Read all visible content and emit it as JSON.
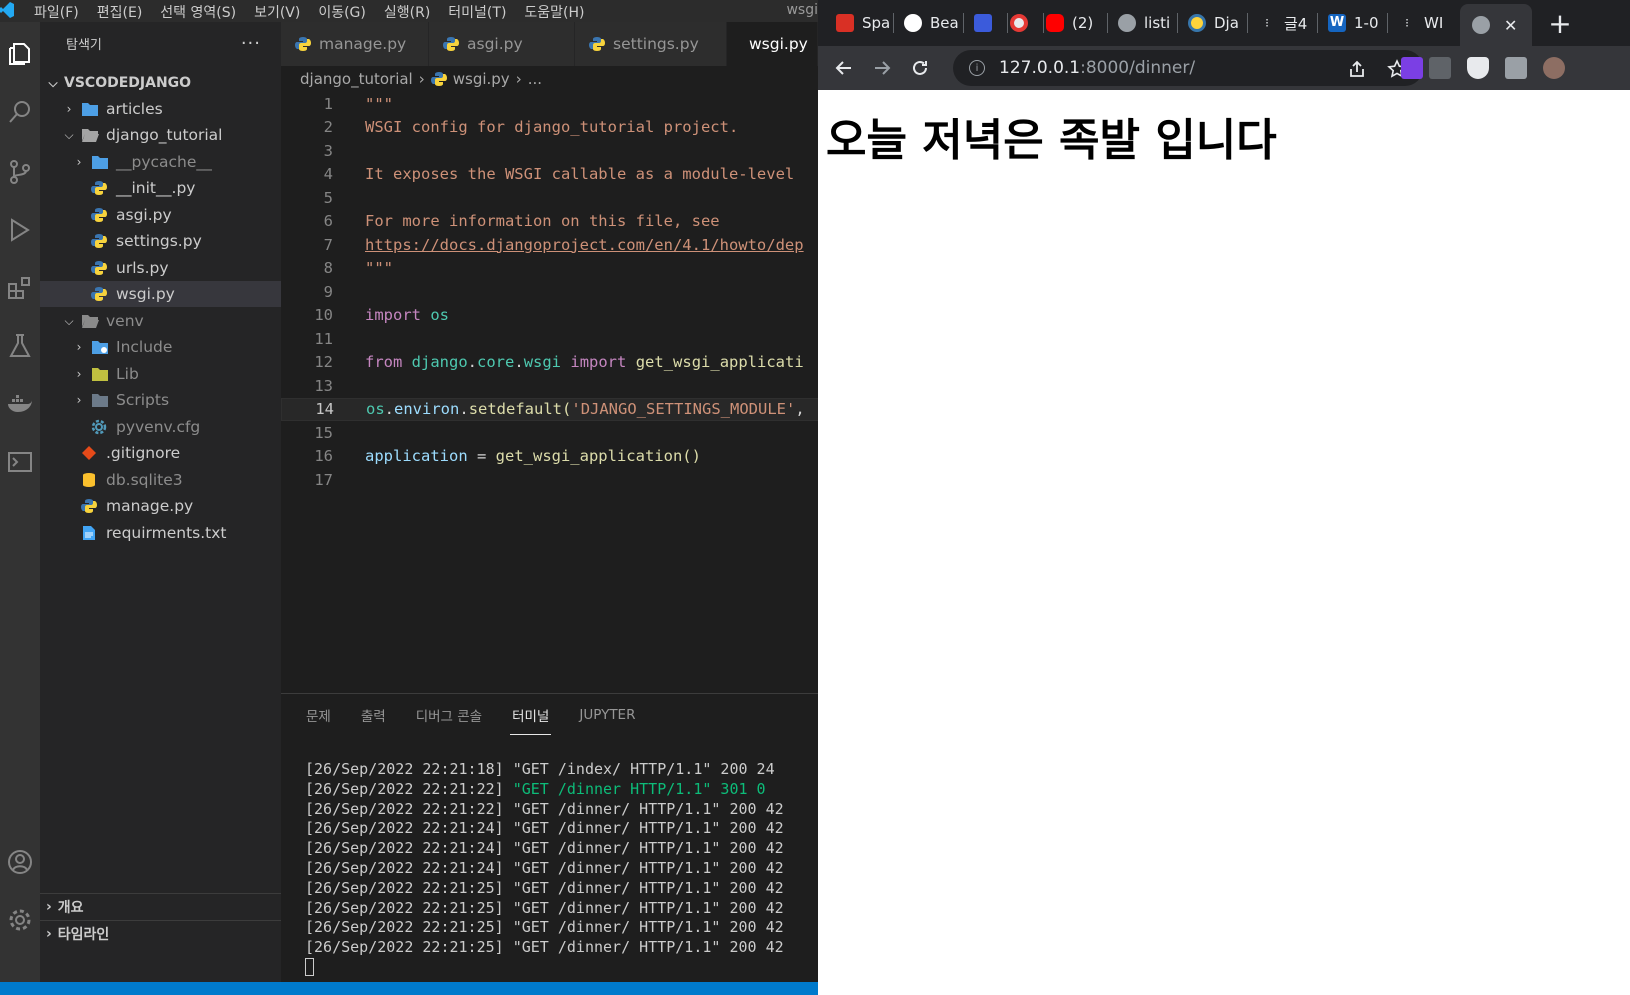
{
  "vscode": {
    "menu": [
      "파일(F)",
      "편집(E)",
      "선택 영역(S)",
      "보기(V)",
      "이동(G)",
      "실행(R)",
      "터미널(T)",
      "도움말(H)"
    ],
    "title_right": "wsgi",
    "explorer_title": "탐색기",
    "explorer_more": "···",
    "tree": {
      "root": "VSCODEDJANGO",
      "articles": "articles",
      "django_tutorial": "django_tutorial",
      "pycache": "__pycache__",
      "init": "__init__.py",
      "asgi": "asgi.py",
      "settings": "settings.py",
      "urls": "urls.py",
      "wsgi": "wsgi.py",
      "venv": "venv",
      "include": "Include",
      "lib": "Lib",
      "scripts": "Scripts",
      "pyvenv": "pyvenv.cfg",
      "gitignore": ".gitignore",
      "db": "db.sqlite3",
      "manage": "manage.py",
      "requirements": "requirments.txt"
    },
    "outline_label": "개요",
    "timeline_label": "타임라인",
    "tabs": [
      "manage.py",
      "asgi.py",
      "settings.py",
      "wsgi.py"
    ],
    "breadcrumb": {
      "folder": "django_tutorial",
      "file": "wsgi.py",
      "more": "..."
    },
    "code": {
      "l1": "\"\"\"",
      "l2": "WSGI config for django_tutorial project.",
      "l4": "It exposes the WSGI callable as a module-level",
      "l6": "For more information on this file, see",
      "l7": "https://docs.djangoproject.com/en/4.1/howto/dep",
      "l8": "\"\"\"",
      "l10_kw": "import",
      "l10_mod": "os",
      "l12_from": "from",
      "l12_mod1": "django",
      "l12_mod2": "core",
      "l12_mod3": "wsgi",
      "l12_import": "import",
      "l12_fn": "get_wsgi_applicati",
      "l14_os": "os",
      "l14_environ": "environ",
      "l14_fn": "setdefault",
      "l14_str": "'DJANGO_SETTINGS_MODULE'",
      "l16_var": "application",
      "l16_eq": " = ",
      "l16_fn": "get_wsgi_application",
      "l16_paren": "()"
    },
    "line_numbers": [
      "1",
      "2",
      "3",
      "4",
      "5",
      "6",
      "7",
      "8",
      "9",
      "10",
      "11",
      "12",
      "13",
      "14",
      "15",
      "16",
      "17"
    ],
    "panel_tabs": [
      "문제",
      "출력",
      "디버그 콘솔",
      "터미널",
      "JUPYTER"
    ],
    "terminal_lines": [
      "[26/Sep/2022 22:21:18] \"GET /index/ HTTP/1.1\" 200 24",
      "[26/Sep/2022 22:21:22] ",
      "[26/Sep/2022 22:21:22] \"GET /dinner/ HTTP/1.1\" 200 42",
      "[26/Sep/2022 22:21:24] \"GET /dinner/ HTTP/1.1\" 200 42",
      "[26/Sep/2022 22:21:24] \"GET /dinner/ HTTP/1.1\" 200 42",
      "[26/Sep/2022 22:21:24] \"GET /dinner/ HTTP/1.1\" 200 42",
      "[26/Sep/2022 22:21:25] \"GET /dinner/ HTTP/1.1\" 200 42",
      "[26/Sep/2022 22:21:25] \"GET /dinner/ HTTP/1.1\" 200 42",
      "[26/Sep/2022 22:21:25] \"GET /dinner/ HTTP/1.1\" 200 42",
      "[26/Sep/2022 22:21:25] \"GET /dinner/ HTTP/1.1\" 200 42"
    ],
    "terminal_redirect": "\"GET /dinner HTTP/1.1\" 301 0",
    "colors": {
      "accent": "#007acc",
      "redirect_green": "#0dbc79"
    }
  },
  "chrome": {
    "tabs": [
      "Spa",
      "Bea",
      "",
      "",
      "(2)",
      "listi",
      "Dja",
      "글4",
      "1-0",
      "WI",
      ""
    ],
    "close_glyph": "✕",
    "new_tab_glyph": "+",
    "url_host": "127.0.0.1",
    "url_path": ":8000/dinner/",
    "page_heading": "오늘 저녁은 족발 입니다"
  }
}
